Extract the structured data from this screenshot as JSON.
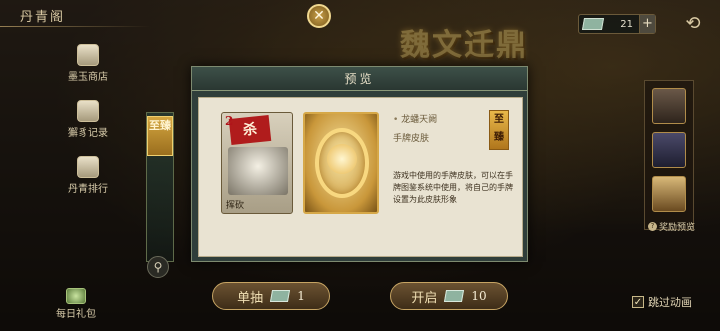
{
  "header": {
    "title": "丹青阁",
    "banner_title": "魏文迁鼎",
    "currency_count": "21",
    "currency_plus": "+",
    "back_glyph": "⟲"
  },
  "left_nav": {
    "items": [
      {
        "label": "墨玉商店",
        "icon": "jade-shop-icon"
      },
      {
        "label": "獬豸记录",
        "icon": "record-scroll-icon"
      },
      {
        "label": "丹青排行",
        "icon": "ranking-icon"
      }
    ],
    "rank_badge": "至臻",
    "daily_gift": "每日礼包"
  },
  "modal": {
    "title": "预览",
    "close_glyph": "✕",
    "card_left": {
      "rank": "2",
      "name": "杀",
      "skill": "挥砍"
    },
    "skin_name": "龙蟠天阙",
    "skin_type": "手牌皮肤",
    "rank_tag": "至臻",
    "description": "游戏中使用的手牌皮肤，可以在手牌图鉴系统中使用，将自己的手牌设置为此皮肤形象"
  },
  "right_panel": {
    "reward_preview": "奖励预览",
    "reward_dot": "?"
  },
  "bottom": {
    "single_draw_label": "单抽",
    "single_draw_cost": "1",
    "open_label": "开启",
    "open_cost": "10",
    "skip_label": "跳过动画",
    "skip_checked": "✓"
  },
  "colors": {
    "accent_gold": "#c6a463",
    "modal_frame": "#2f3e3a",
    "card_red": "#b01c1c"
  }
}
